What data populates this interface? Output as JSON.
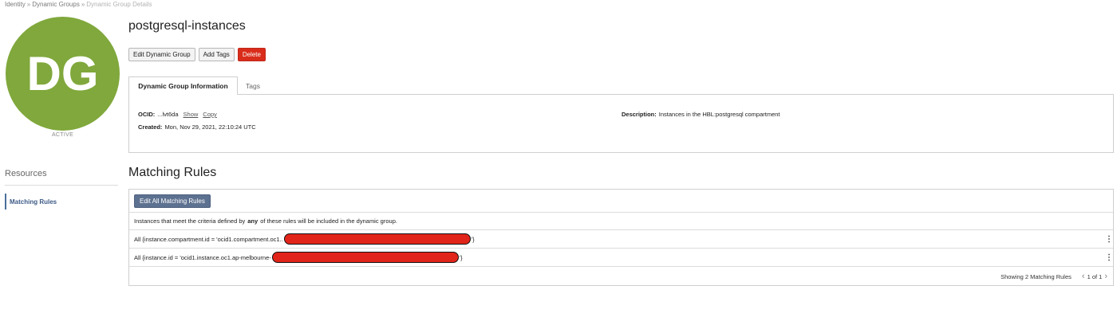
{
  "breadcrumb": {
    "items": [
      "Identity",
      "Dynamic Groups",
      "Dynamic Group Details"
    ],
    "separator": "»"
  },
  "resource": {
    "initials": "DG",
    "status": "ACTIVE",
    "name": "postgresql-instances",
    "avatar_color": "#80a83c"
  },
  "actions": {
    "edit": "Edit Dynamic Group",
    "add_tags": "Add Tags",
    "delete": "Delete"
  },
  "tabs": {
    "info": "Dynamic Group Information",
    "tags": "Tags"
  },
  "info": {
    "ocid_label": "OCID:",
    "ocid_value": "...lvt6da",
    "show": "Show",
    "copy": "Copy",
    "created_label": "Created:",
    "created_value": "Mon, Nov 29, 2021, 22:10:24 UTC",
    "description_label": "Description:",
    "description_value": "Instances in the HBL:postgresql compartment"
  },
  "resources": {
    "title": "Resources",
    "items": [
      "Matching Rules"
    ]
  },
  "rules": {
    "title": "Matching Rules",
    "edit_all": "Edit All Matching Rules",
    "desc_before": "Instances that meet the criteria defined by",
    "desc_bold": "any",
    "desc_after": "of these rules will be included in the dynamic group.",
    "items": [
      {
        "prefix": "All {instance.compartment.id = 'ocid1.compartment.oc1..",
        "suffix": "'}"
      },
      {
        "prefix": "All {instance.id = 'ocid1.instance.oc1.ap-melbourne-",
        "suffix": "'}"
      }
    ],
    "footer": "Showing 2 Matching Rules",
    "page": "1 of 1"
  },
  "colors": {
    "delete": "#d92c1a",
    "primary": "#5d7190",
    "redaction": "#e2251a"
  }
}
